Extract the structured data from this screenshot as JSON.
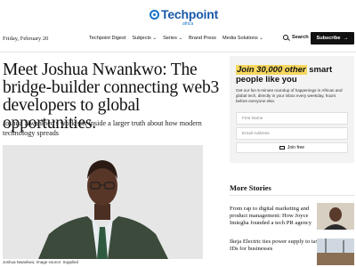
{
  "brand": {
    "name": "Techpoint",
    "sub": "africa",
    "color": "#1a5aa8"
  },
  "nav": {
    "date": "Friday, February 20",
    "links": [
      "Techpoint Digest",
      "Subjects ⌄",
      "Series ⌄",
      "Brand Press",
      "Media Solutions ⌄"
    ],
    "search_label": "Search",
    "subscribe_label": "Subscribe",
    "subscribe_arrow": "→"
  },
  "article": {
    "headline": "Meet Joshua Nwankwo: The bridge-builder connecting web3 developers to global opportunities.",
    "dek": "Joshua Nwankwo's work sits inside a larger truth about how modern technology spreads",
    "image_caption": "Joshua Nwankwo; Image source: Supplied"
  },
  "signup": {
    "title_highlight": "Join 30,000 other",
    "title_rest": "smart people like you",
    "description": "Get our fun 5-minute roundup of happenings in African and global tech, directly in your inbox every weekday, hours before everyone else.",
    "first_name_placeholder": "First Name",
    "email_placeholder": "Email Address",
    "join_label": "Join free",
    "highlight_color": "#f6d860"
  },
  "more_stories": {
    "title": "More Stories",
    "items": [
      {
        "title": "From rap to digital marketing and product management: How Joyce Imiegha founded a tech PR agency"
      },
      {
        "title": "Ikeja Electric ties power supply to tax IDs for businesses"
      }
    ]
  }
}
